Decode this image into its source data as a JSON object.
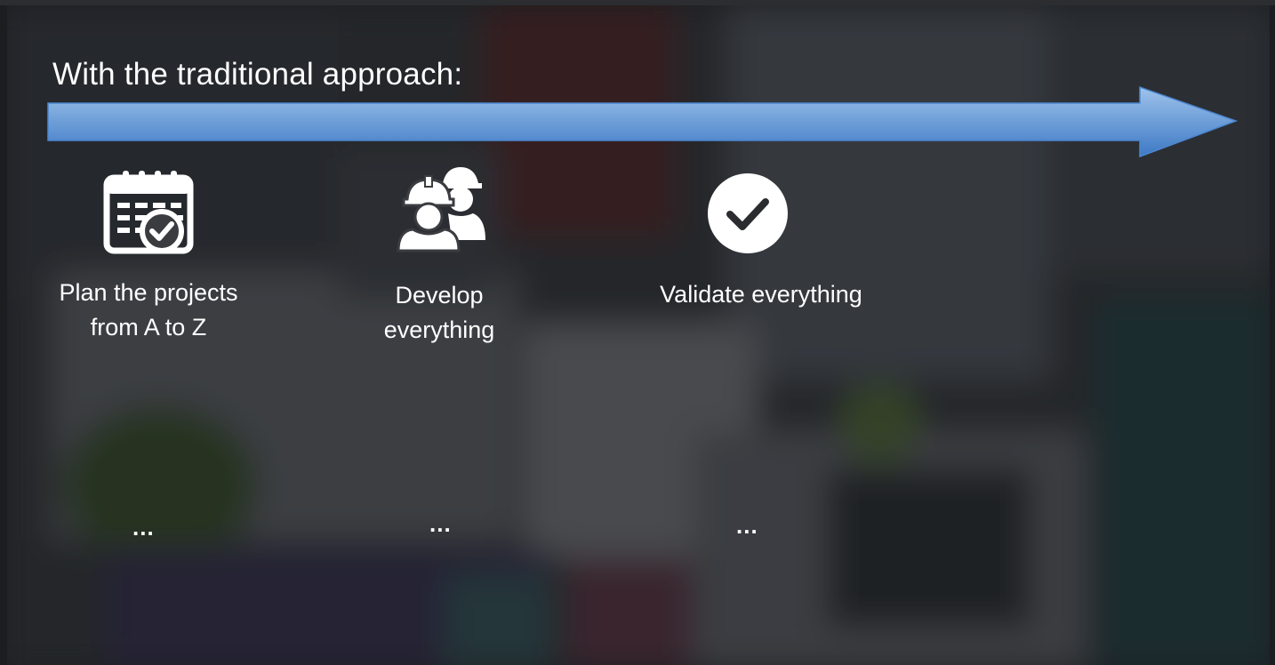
{
  "heading": "With the traditional approach:",
  "colors": {
    "arrow_light": "#9fc3ec",
    "arrow_dark": "#3d79c4",
    "text": "#ffffff"
  },
  "steps": [
    {
      "icon": "calendar-check-icon",
      "label": "Plan the projects from A to Z",
      "trailing": "..."
    },
    {
      "icon": "workers-hardhat-icon",
      "label": "Develop everything",
      "trailing": "..."
    },
    {
      "icon": "checkmark-circle-icon",
      "label": "Validate everything",
      "trailing": "..."
    }
  ]
}
